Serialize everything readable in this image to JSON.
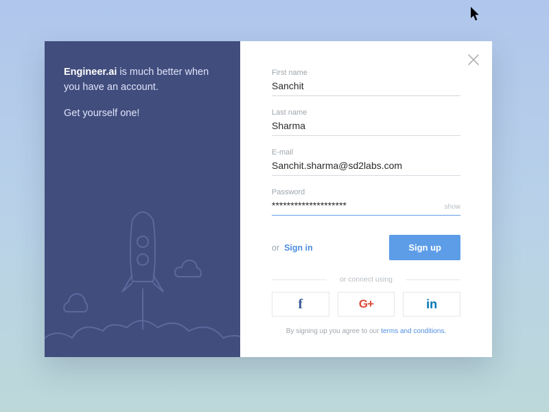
{
  "left": {
    "tagline_strong": "Engineer.ai",
    "tagline_rest": " is much better when you have an account.",
    "cta": "Get yourself one!"
  },
  "form": {
    "first_name": {
      "label": "First name",
      "value": "Sanchit"
    },
    "last_name": {
      "label": "Last name",
      "value": "Sharma"
    },
    "email": {
      "label": "E-mail",
      "value": "Sanchit.sharma@sd2labs.com"
    },
    "password": {
      "label": "Password",
      "value": "********************",
      "show": "show"
    }
  },
  "actions": {
    "or": "or",
    "signin": "Sign in",
    "signup": "Sign up"
  },
  "divider": "or connect using",
  "social": {
    "facebook": "f",
    "google": "G+",
    "linkedin": "in"
  },
  "legal": {
    "prefix": "By signing up you agree to our ",
    "link": "terms and conditions."
  }
}
